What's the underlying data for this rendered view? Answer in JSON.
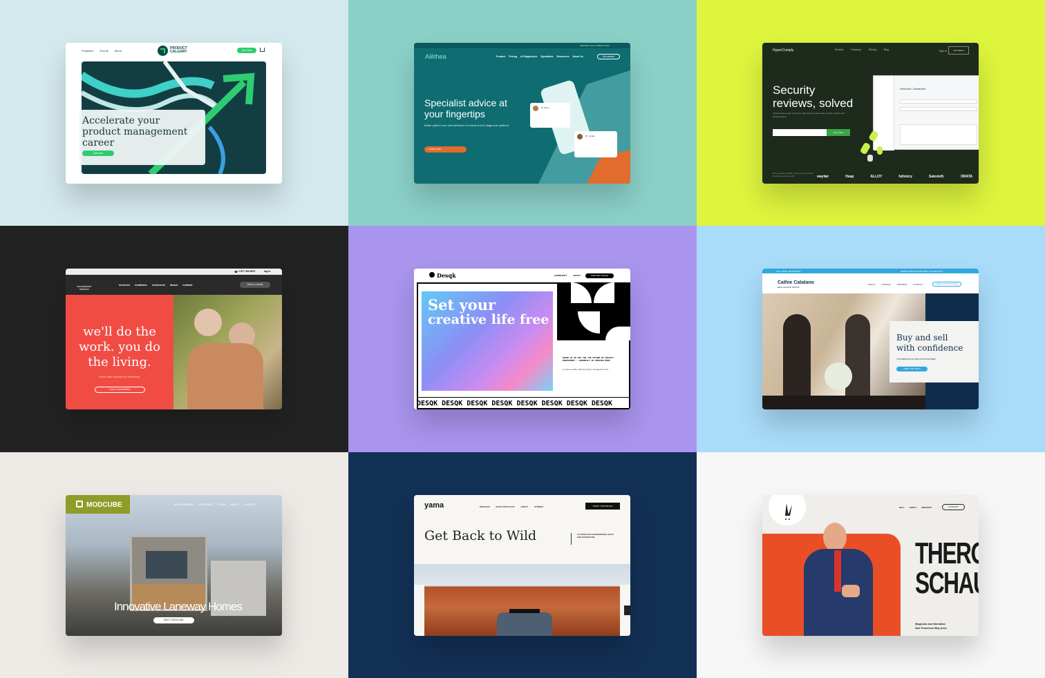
{
  "colors": {
    "bg1": "#d4e9ee",
    "bg2": "#8bd0c7",
    "bg3": "#ddf53d",
    "bg4": "#222222",
    "bg5": "#a994ee",
    "bg6": "#a9dcf9",
    "bg7": "#edeae6",
    "bg8": "#133055",
    "bg9": "#f7f7f7"
  },
  "pc": {
    "nav": [
      "Programs",
      "Events",
      "About"
    ],
    "logo": "PRODUCT\nCALGARY",
    "join": "Join Now",
    "headline": [
      "Accelerate your",
      "product management",
      "career"
    ],
    "cta": "Join now"
  },
  "al": {
    "top": "Physician Log In  |  Patient Log In",
    "logo": "Alēthea",
    "nav": [
      "Product",
      "Pricing",
      "AI Diagnostics",
      "Specialties",
      "Resources",
      "About Us"
    ],
    "btn": "Get started",
    "h1": "Specialist advice at",
    "h2": "your fingertips",
    "sub": "Better patient care with Alethea's eConsult and AI diagnostic platform.",
    "cta": "Learn more",
    "doc1": "Dr. Boris",
    "doc2": "Dr. Jordan"
  },
  "hc": {
    "logo": "HyperComply",
    "nav": [
      "Product",
      "Company",
      "Pricing",
      "Blog"
    ],
    "signin": "Sign In",
    "started": "Get Started",
    "h1": "Security",
    "h2": "reviews, solved",
    "sub": "Using AI and a team of experts, HyperComply automates security reviews and questionnaires.",
    "cta": "Learn More",
    "welcome": "Welcome, Samantha",
    "logos": [
      "wayfair",
      "Heap",
      "ALLOY",
      "fullstory",
      "Salesloft.",
      "DRATA"
    ],
    "trust": "We've saved 10,000+ hours for the smartest businesses in the world"
  },
  "cn": {
    "phone": "1 877 404 9670",
    "login": "log in",
    "logo": "compassion\nnetwork",
    "nav": [
      "services",
      "locations",
      "resources",
      "about",
      "contact"
    ],
    "btn": "book a consult",
    "h": [
      "we'll do the",
      "work. you do",
      "the living."
    ],
    "sub": "Home care services for Albertans.",
    "cta": "book a consultation"
  },
  "dq": {
    "logo": "Desqk",
    "nav": [
      "COMMUNITY",
      "ABOUT"
    ],
    "btn": "PREVIEW DESQK",
    "h1": "Set your",
    "h2": "creative life free",
    "desc": "DESQK IS AN APP FOR THE FUTURE OF PROJECT MANAGEMENT - CURRENTLY IN PREVIEW MODE.",
    "body": "A custom-made, tailored project management tool",
    "ticker": "DESQK DESQK DESQK DESQK DESQK DESQK DESQK DESQK"
  },
  "cc": {
    "topleft": "CALL NOW: 403.650.6267",
    "topright": "SEARCHING WITH BUYERS | CATHIE TEXT",
    "name": "Cathie Catalano",
    "group": "REAL ESTATE GROUP",
    "nav": [
      "ABOUT",
      "LISTINGS",
      "PROCESS",
      "CONTACT"
    ],
    "btn": "FREE CONSULTATION",
    "h1": "Buy and sell",
    "h2": "with confidence",
    "sub": "YOUR MEDICINE HAT REAL ESTATE PARTNERS",
    "cta": "MEET THE TEAM"
  },
  "mc": {
    "logo": "MODCUBE",
    "nav": [
      "WHY MODCUBE?",
      "CUSTOMIZE",
      "LEARN",
      "ABOUT",
      "CONTACT"
    ],
    "h": "Innovative Laneway Homes",
    "cta": "MEET MODCUBE"
  },
  "ym": {
    "logo": "yama",
    "nav": [
      "PROCESS",
      "BUILD SPOTLIGHT",
      "ABOUT",
      "STORIES"
    ],
    "btn": "START YOUR BUILD",
    "h": "Get Back to Wild",
    "sub": "CUSTOM VAN CONVERSIONS, BUILT FOR ADVENTURE"
  },
  "ts": {
    "nav": [
      "SELL",
      "ABOUT",
      "SERVICES"
    ],
    "btn": "CONTACT",
    "n1": "THERON",
    "n2": "SCHAUB",
    "s1": "Magician and Mentalist",
    "s2": "San Francisco Bay Area"
  }
}
